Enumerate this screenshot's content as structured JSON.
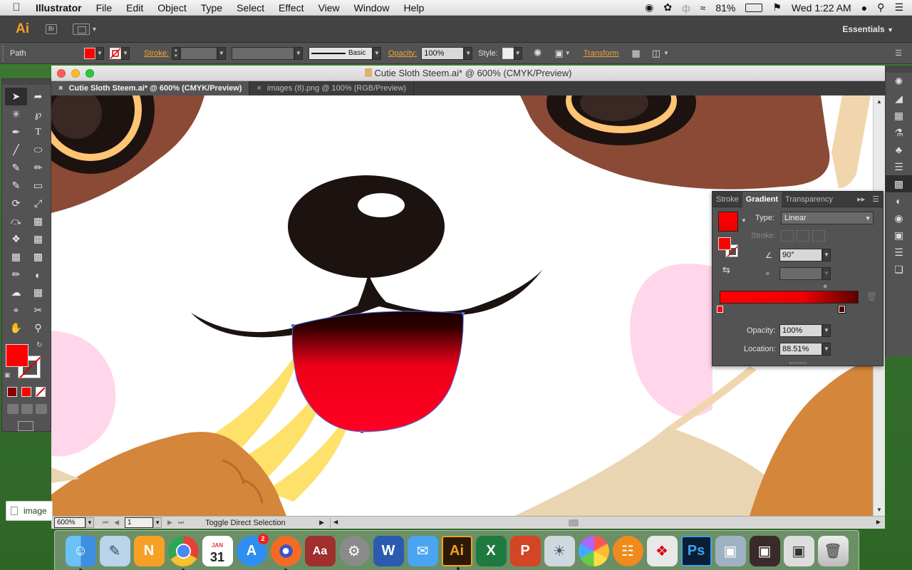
{
  "menubar": {
    "app_name": "Illustrator",
    "items": [
      "File",
      "Edit",
      "Object",
      "Type",
      "Select",
      "Effect",
      "View",
      "Window",
      "Help"
    ],
    "battery": "81%",
    "clock": "Wed 1:22 AM"
  },
  "appbar": {
    "logo": "Ai",
    "bridge": "Br",
    "workspace": "Essentials"
  },
  "control": {
    "selection_type": "Path",
    "stroke_label": "Stroke:",
    "brush_label": "Basic",
    "opacity_label": "Opacity:",
    "opacity_value": "100%",
    "style_label": "Style:",
    "transform_label": "Transform",
    "colors": {
      "fill": "#ff0000"
    }
  },
  "document": {
    "title": "Cutie Sloth Steem.ai* @ 600% (CMYK/Preview)",
    "tabs": [
      {
        "label": "Cutie Sloth Steem.ai* @ 600% (CMYK/Preview)",
        "active": true
      },
      {
        "label": "images (8).png @ 100% (RGB/Preview)",
        "active": false
      }
    ],
    "zoom": "600%",
    "artboard": "1",
    "status": "Toggle Direct Selection"
  },
  "gradient_panel": {
    "tabs": [
      "Stroke",
      "Gradient",
      "Transparency"
    ],
    "type_label": "Type:",
    "type_value": "Linear",
    "stroke_label": "Stroke:",
    "angle_value": "90°",
    "opacity_label": "Opacity:",
    "opacity_value": "100%",
    "location_label": "Location:",
    "location_value": "88.51%",
    "gradient_start": "#ff0000",
    "gradient_end": "#5a0000"
  },
  "desktop_item": "image",
  "dock": {
    "apps": [
      "Finder",
      "Preview",
      "Notability",
      "Chrome",
      "Calendar",
      "App Store",
      "Firefox",
      "Dictionary",
      "System Preferences",
      "Word",
      "Mail",
      "Illustrator",
      "Excel",
      "PowerPoint",
      "Photo Viewer",
      "Photos",
      "iBooks",
      "Acrobat",
      "Photoshop",
      "Image Capture",
      "Movie",
      "Screenshot",
      "Trash"
    ],
    "calendar_month": "JAN",
    "calendar_day": "31",
    "appstore_badge": "2",
    "ai_label": "Ai",
    "ps_label": "Ps"
  }
}
